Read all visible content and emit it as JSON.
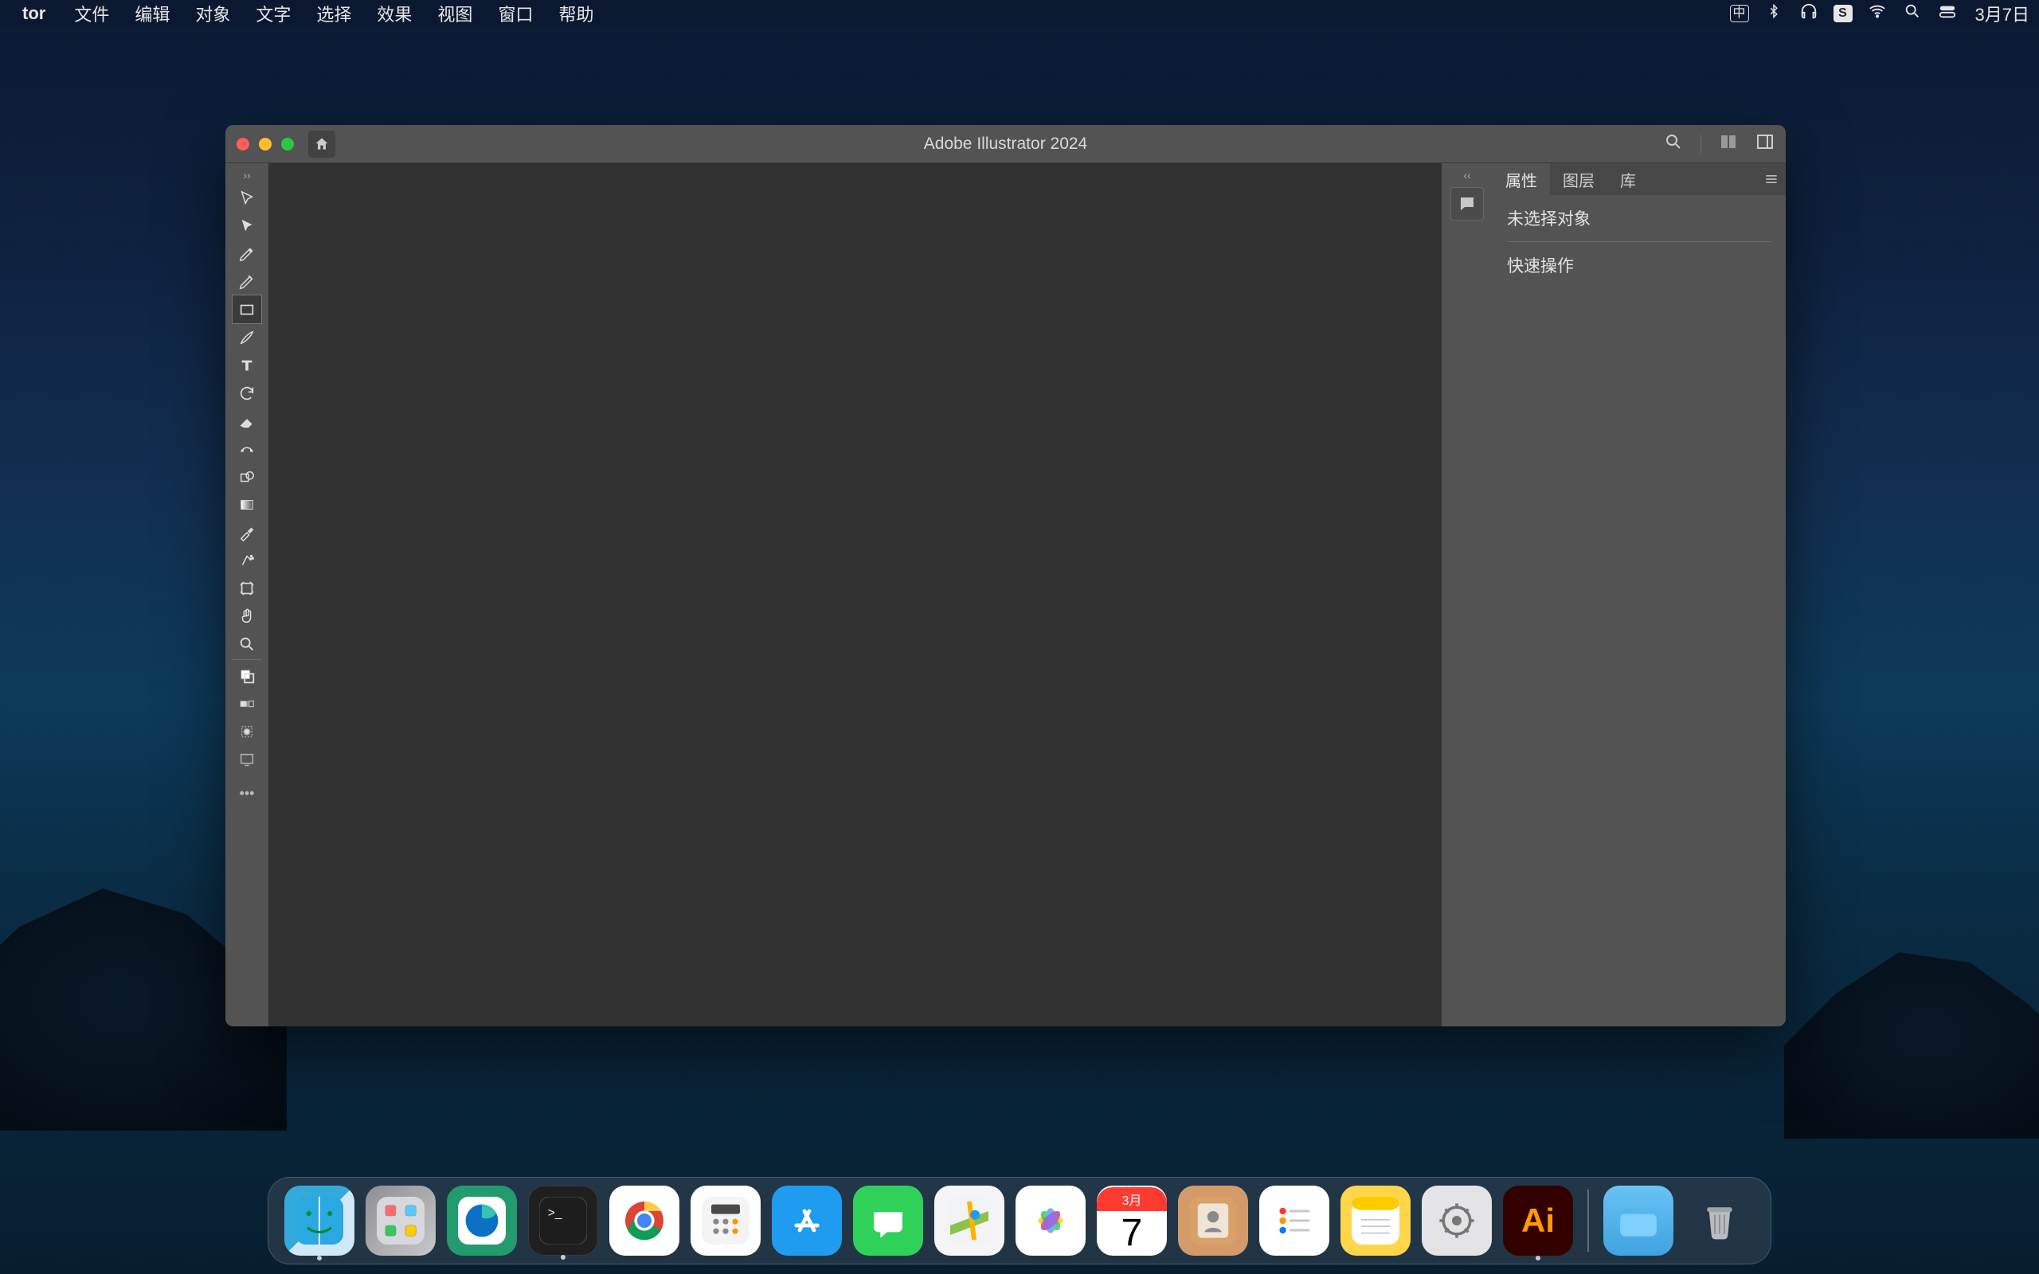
{
  "menubar": {
    "app_name": "tor",
    "items": [
      "文件",
      "编辑",
      "对象",
      "文字",
      "选择",
      "效果",
      "视图",
      "窗口",
      "帮助"
    ],
    "right": {
      "input_label": "中",
      "s_label": "S",
      "date": "3月7日"
    }
  },
  "window": {
    "title": "Adobe Illustrator 2024"
  },
  "panel": {
    "tabs": [
      "属性",
      "图层",
      "库"
    ],
    "active_tab_index": 0,
    "noselection": "未选择对象",
    "quick_actions": "快速操作"
  },
  "dock": {
    "cal_month": "3月",
    "cal_day": "7",
    "ai_label": "Ai"
  }
}
